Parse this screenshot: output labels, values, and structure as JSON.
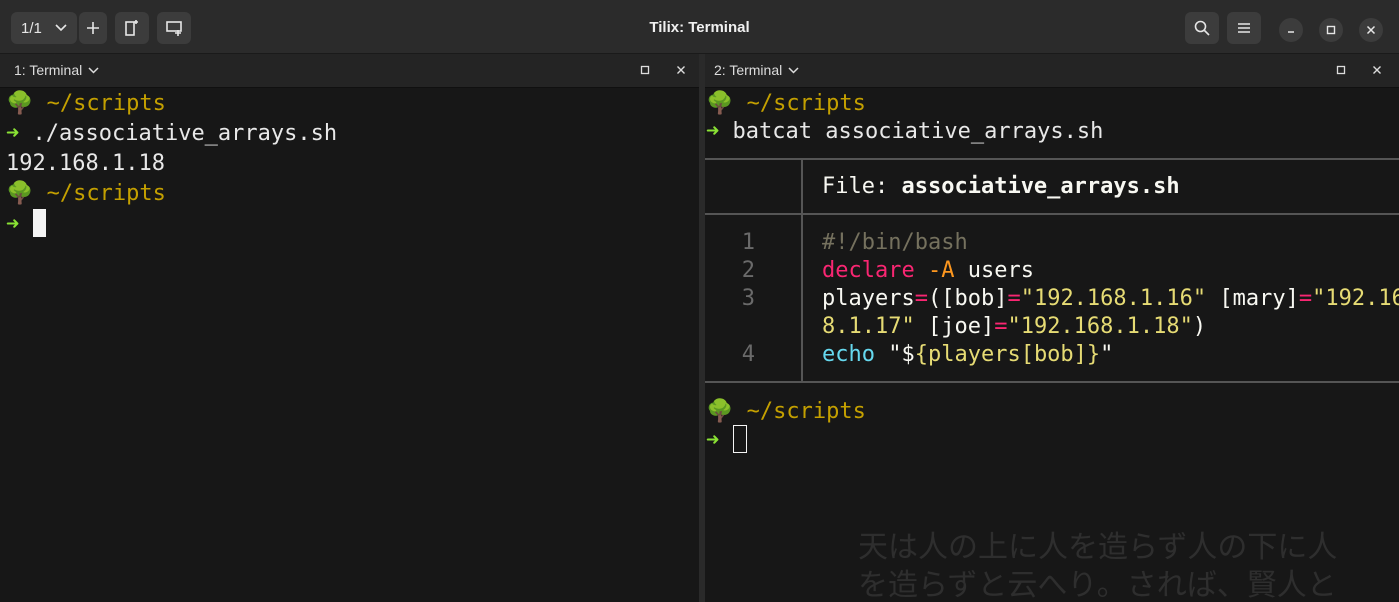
{
  "window": {
    "title": "Tilix: Terminal",
    "session_label": "1/1"
  },
  "panes": {
    "left": {
      "title": "1: Terminal"
    },
    "right": {
      "title": "2: Terminal"
    }
  },
  "left_terminal": {
    "prompt_path": "~/scripts",
    "command": "./associative_arrays.sh",
    "output": "192.168.1.18"
  },
  "right_terminal": {
    "prompt_path": "~/scripts",
    "command": "batcat associative_arrays.sh",
    "file_label": "File: ",
    "file_name": "associative_arrays.sh",
    "code": {
      "n1": "1",
      "l1": "#!/bin/bash",
      "n2": "2",
      "l2_kw": "declare",
      "l2_opt": "-A",
      "l2_rest": "users",
      "n3": "3",
      "l3_a": "players",
      "l3_b": "=",
      "l3_c": "([bob]",
      "l3_d": "=",
      "l3_e": "\"192.168.1.16\"",
      "l3_f": " [mary]",
      "l3_g": "=",
      "l3_h": "\"192.16",
      "l3w_a": "8.1.17\"",
      "l3w_b": " [joe]",
      "l3w_c": "=",
      "l3w_d": "\"192.168.1.18\"",
      "l3w_e": ")",
      "n4": "4",
      "l4_a": "echo",
      "l4_b": " \"$",
      "l4_c": "{players[bob]}",
      "l4_d": "\""
    }
  },
  "watermark": {
    "line1": "天は人の上に人を造らず人の下に人",
    "line2": "を造らずと云へり。されば、賢人と"
  }
}
